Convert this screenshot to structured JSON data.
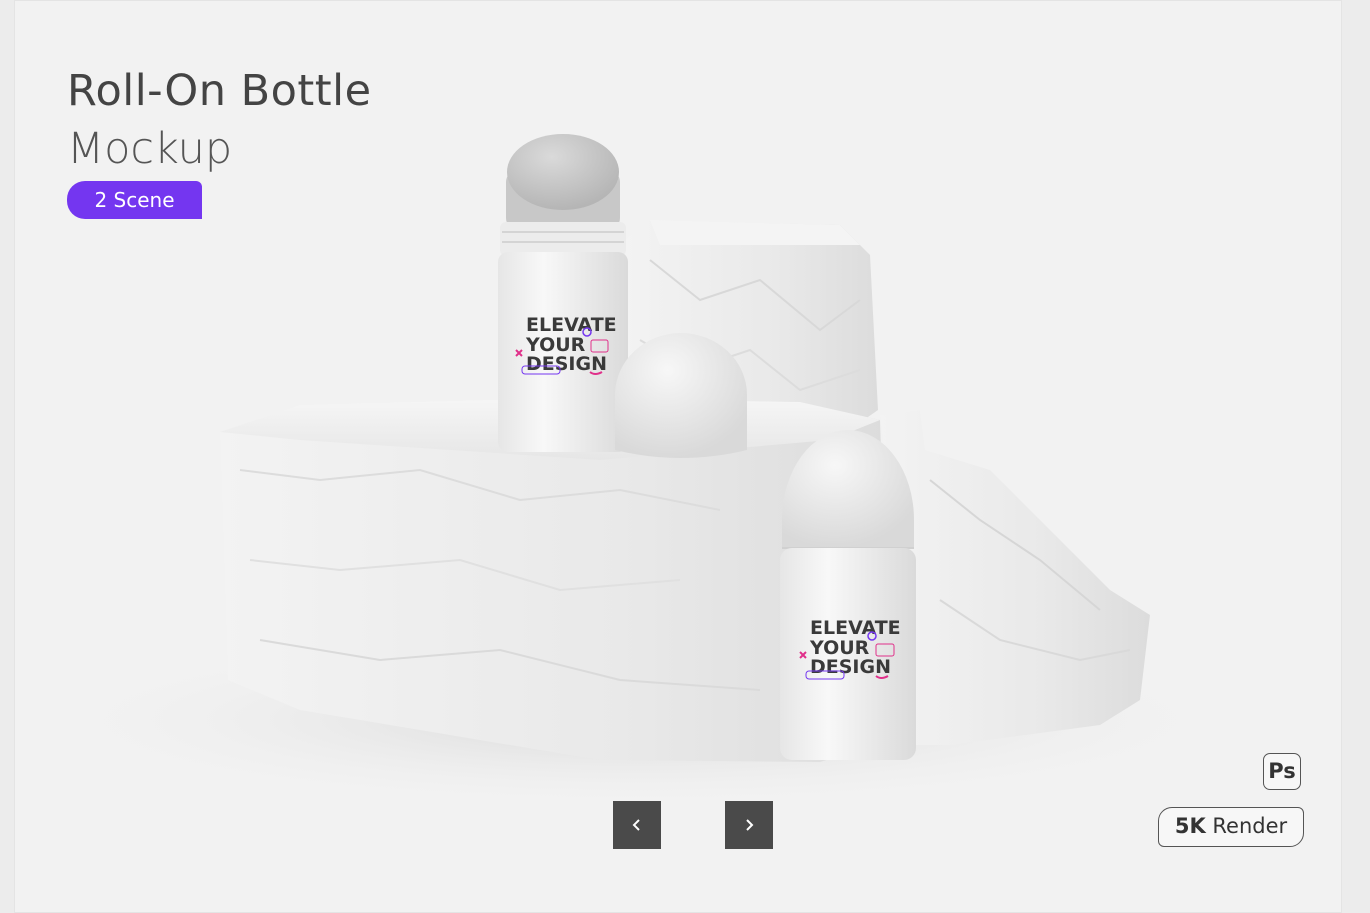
{
  "header": {
    "title": "Roll-On Bottle",
    "subtitle": "Mockup",
    "badge": "2 Scene"
  },
  "label": {
    "line1": "ELEVATE",
    "line2": "YOUR",
    "line3": "DESIGN"
  },
  "navigation": {
    "prev_icon": "chevron-left-icon",
    "next_icon": "chevron-right-icon"
  },
  "footer": {
    "ps": "Ps",
    "render_strong": "5K",
    "render_text": " Render"
  },
  "colors": {
    "accent": "#7436f0",
    "nav": "#4a4a4a",
    "background": "#f2f2f2"
  }
}
